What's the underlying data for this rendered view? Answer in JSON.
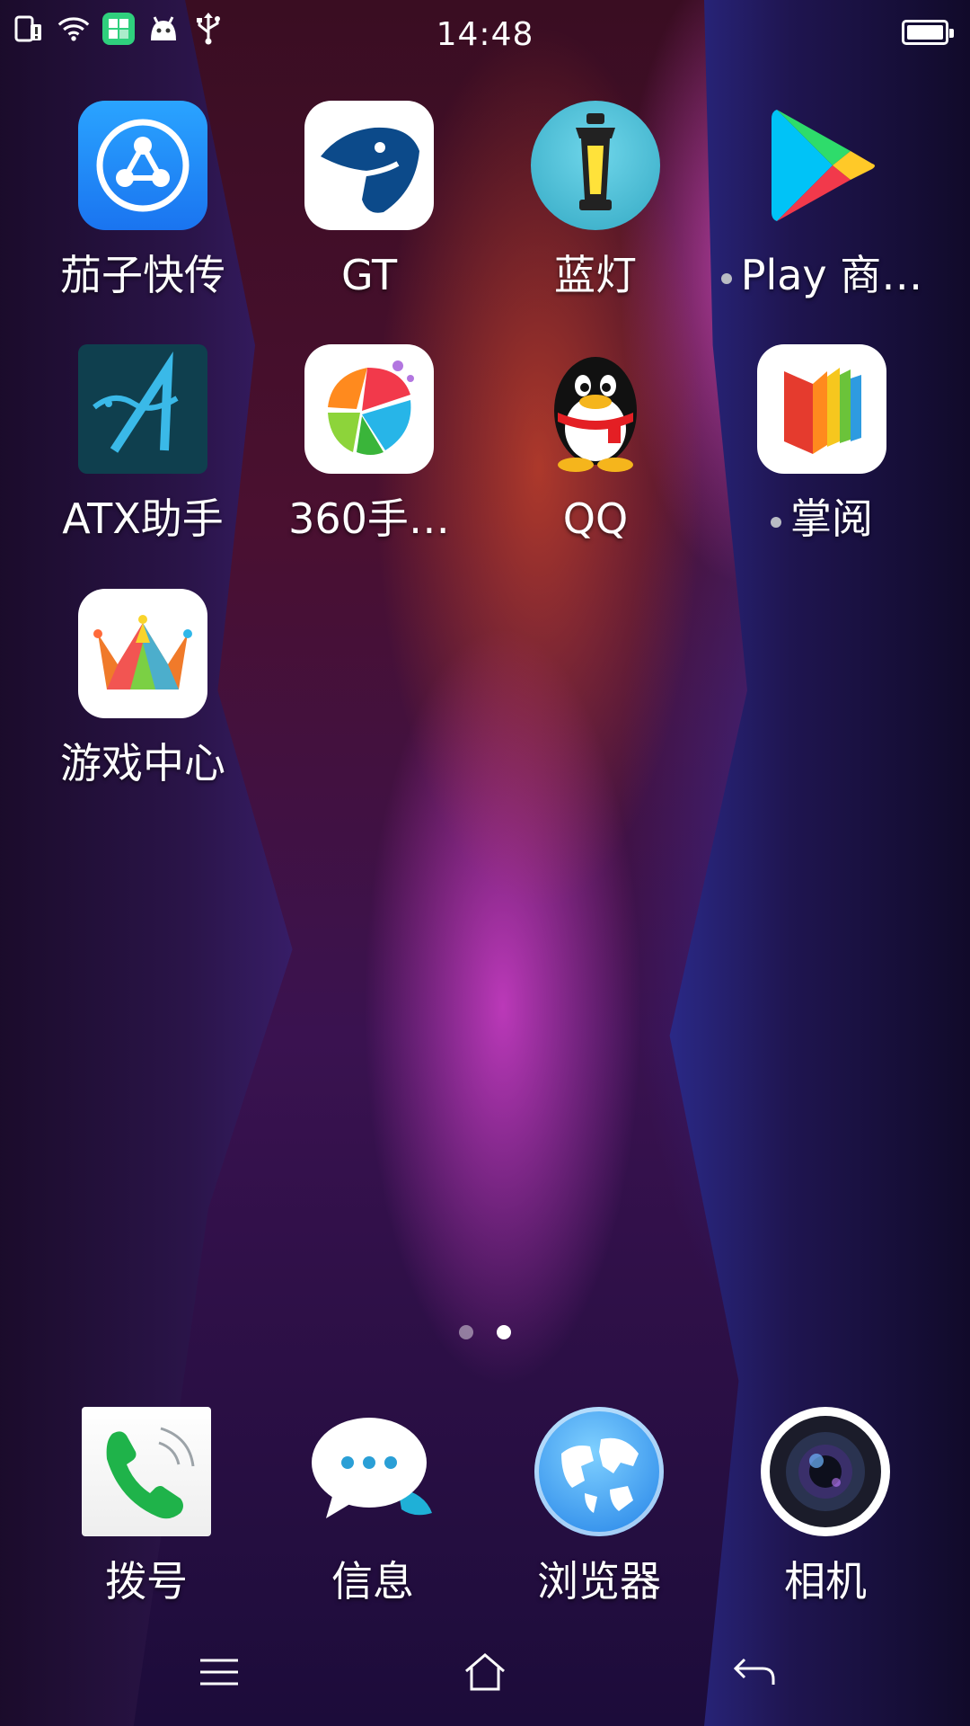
{
  "status_bar": {
    "time": "14:48",
    "icons": [
      "sim-alert-icon",
      "wifi-icon",
      "app-notification-icon",
      "android-debug-icon",
      "usb-icon"
    ],
    "battery_level": 1.0
  },
  "home_apps": [
    {
      "label": "茄子快传",
      "icon": "share-icon"
    },
    {
      "label": "GT",
      "icon": "gt-bird-icon"
    },
    {
      "label": "蓝灯",
      "icon": "lantern-icon"
    },
    {
      "label": "Play 商…",
      "icon": "play-store-icon",
      "new": true
    },
    {
      "label": "ATX助手",
      "icon": "atx-icon"
    },
    {
      "label": "360手…",
      "icon": "360-ball-icon"
    },
    {
      "label": "QQ",
      "icon": "qq-penguin-icon"
    },
    {
      "label": "掌阅",
      "icon": "book-icon",
      "new": true
    },
    {
      "label": "游戏中心",
      "icon": "crown-icon"
    }
  ],
  "dock_apps": [
    {
      "label": "拨号",
      "icon": "phone-icon"
    },
    {
      "label": "信息",
      "icon": "message-icon"
    },
    {
      "label": "浏览器",
      "icon": "globe-icon"
    },
    {
      "label": "相机",
      "icon": "camera-icon"
    }
  ],
  "page_indicator": {
    "total": 2,
    "current": 2
  },
  "nav_bar": [
    "menu-icon",
    "home-icon",
    "back-icon"
  ]
}
